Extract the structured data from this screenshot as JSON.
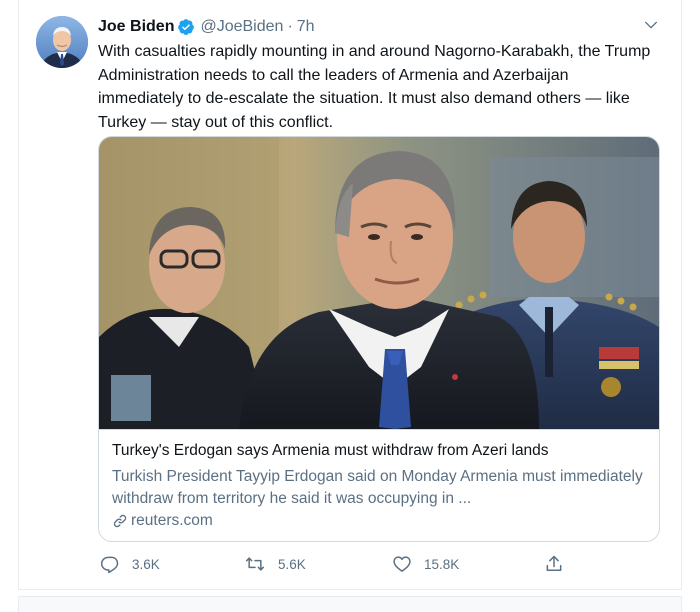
{
  "tweet": {
    "author_name": "Joe Biden",
    "author_handle": "@JoeBiden",
    "separator": "·",
    "time": "7h",
    "text": "With casualties rapidly mounting in and around Nagorno-Karabakh, the Trump Administration needs to call the leaders of Armenia and Azerbaijan immediately to de-escalate the situation. It must also demand others — like Turkey — stay out of this conflict."
  },
  "card": {
    "title": "Turkey's Erdogan says Armenia must withdraw from Azeri lands",
    "description": "Turkish President Tayyip Erdogan said on Monday Armenia must immediately withdraw from territory he said it was occupying in ...",
    "domain": "reuters.com"
  },
  "actions": {
    "reply_count": "3.6K",
    "retweet_count": "5.6K",
    "like_count": "15.8K"
  },
  "icons": {
    "verified": "verified-badge-icon",
    "caret": "chevron-down-icon",
    "link": "link-icon",
    "reply": "reply-icon",
    "retweet": "retweet-icon",
    "like": "heart-icon",
    "share": "share-icon"
  },
  "colors": {
    "verified_blue": "#1da1f2",
    "secondary_text": "#5b7083",
    "border": "#cfd9de"
  }
}
